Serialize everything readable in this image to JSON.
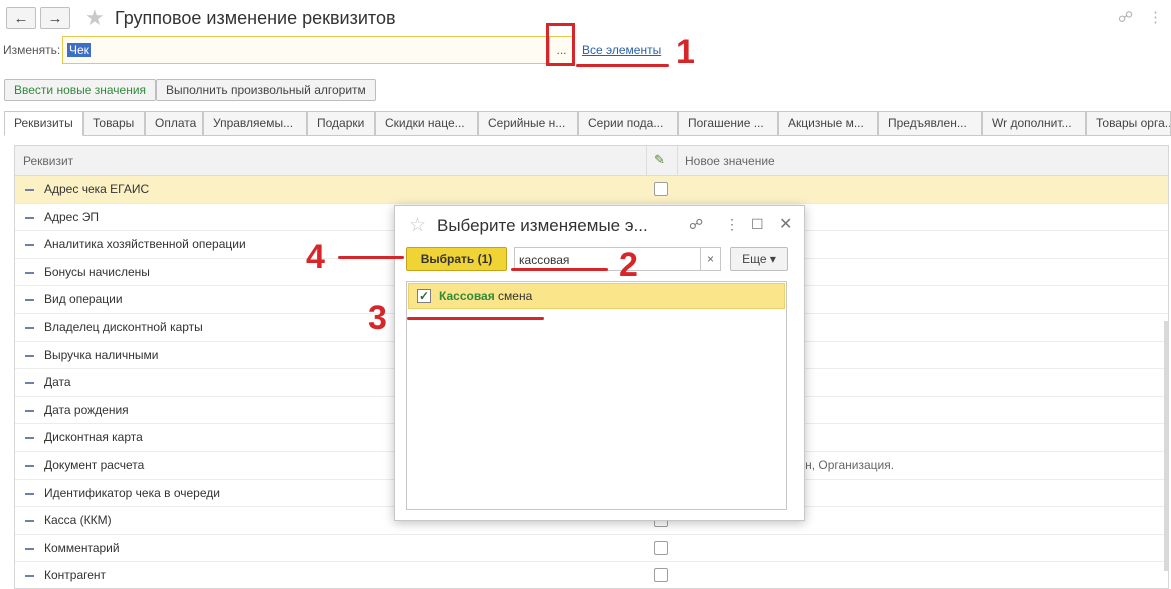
{
  "header": {
    "back_icon": "←",
    "forward_icon": "→",
    "title": "Групповое изменение реквизитов",
    "link_icon": "🔗",
    "more_icon": "⋮"
  },
  "change": {
    "label": "Изменять:",
    "value": "Чек",
    "select_button": "...",
    "all_link": "Все элементы"
  },
  "actions": {
    "enter_values": "Ввести новые значения",
    "run_algorithm": "Выполнить произвольный алгоритм"
  },
  "tabs": [
    "Реквизиты",
    "Товары",
    "Оплата",
    "Управляемы...",
    "Подарки",
    "Скидки наце...",
    "Серийные н...",
    "Серии пода...",
    "Погашение ...",
    "Акцизные м...",
    "Предъявлен...",
    "Wr дополнит...",
    "Товары орга..."
  ],
  "table": {
    "col_attribute": "Реквизит",
    "col_new_value": "Новое значение",
    "rows": [
      {
        "name": "Адрес чека ЕГАИС",
        "value": ""
      },
      {
        "name": "Адрес ЭП",
        "value": ""
      },
      {
        "name": "Аналитика хозяйственной операции",
        "value": ""
      },
      {
        "name": "Бонусы начислены",
        "value": ""
      },
      {
        "name": "Вид операции",
        "value": ""
      },
      {
        "name": "Владелец дисконтной карты",
        "value": ""
      },
      {
        "name": "Выручка наличными",
        "value": ""
      },
      {
        "name": "Дата",
        "value": ""
      },
      {
        "name": "Дата рождения",
        "value": ""
      },
      {
        "name": "Дисконтная карта",
        "value": ""
      },
      {
        "name": "Документ расчета",
        "value": "в: Контрагент, Магазин, Организация."
      },
      {
        "name": "Идентификатор чека в очереди",
        "value": ""
      },
      {
        "name": "Касса (ККМ)",
        "value": ""
      },
      {
        "name": "Комментарий",
        "value": ""
      },
      {
        "name": "Контрагент",
        "value": ""
      }
    ]
  },
  "dialog": {
    "title": "Выберите изменяемые э...",
    "choose_button": "Выбрать (1)",
    "search_value": "кассовая",
    "clear_icon": "×",
    "more_button": "Еще ▾",
    "item_highlight": "Кассовая",
    "item_rest": " смена",
    "item_checked": "✓"
  },
  "annotations": [
    "1",
    "2",
    "3",
    "4"
  ],
  "colors": {
    "accent_red": "#d7262a",
    "choose_yellow": "#f0d335",
    "selected_row": "#fbf1c5"
  }
}
